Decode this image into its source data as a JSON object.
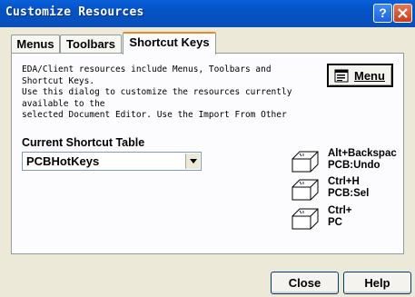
{
  "window": {
    "title": "Customize Resources",
    "help_glyph": "?"
  },
  "tabs": [
    {
      "label": "Menus",
      "active": false
    },
    {
      "label": "Toolbars",
      "active": false
    },
    {
      "label": "Shortcut Keys",
      "active": true
    }
  ],
  "description": [
    "EDA/Client resources include Menus, Toolbars and",
    "Shortcut Keys.",
    "Use this dialog to customize the resources currently",
    "available to the",
    "selected Document Editor. Use the Import From Other"
  ],
  "menu_button": {
    "label_prefix": "",
    "label_mnemonic": "Menu",
    "icon": "menu-icon"
  },
  "shortcut_table": {
    "label": "Current Shortcut Table",
    "selected": "PCBHotKeys"
  },
  "shortcuts": [
    {
      "key": "Alt+Backspac",
      "action": "PCB:Undo"
    },
    {
      "key": "Ctrl+H",
      "action": "PCB:Sel"
    },
    {
      "key": "Ctrl+",
      "action": "PC"
    }
  ],
  "buttons": {
    "close": "Close",
    "help": "Help"
  },
  "colors": {
    "titlebar": "#0a5fd8",
    "dialog_bg": "#ece9d8",
    "tab_accent": "#e68b2c"
  }
}
